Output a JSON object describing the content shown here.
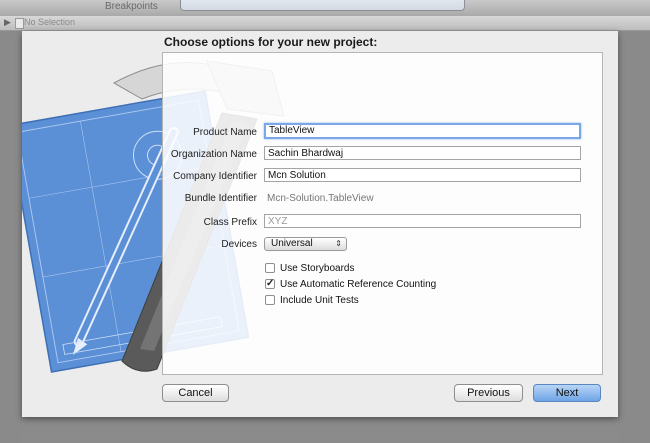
{
  "toolbar": {
    "breakpoints_label": "Breakpoints"
  },
  "jumpbar": {
    "crumb": "No Selection"
  },
  "sheet": {
    "title": "Choose options for your new project:",
    "fields": {
      "product_name": {
        "label": "Product Name",
        "value": "TableView"
      },
      "organization_name": {
        "label": "Organization Name",
        "value": "Sachin Bhardwaj"
      },
      "company_identifier": {
        "label": "Company Identifier",
        "value": "Mcn Solution"
      },
      "bundle_identifier": {
        "label": "Bundle Identifier",
        "value": "Mcn-Solution.TableView"
      },
      "class_prefix": {
        "label": "Class Prefix",
        "placeholder": "XYZ"
      },
      "devices": {
        "label": "Devices",
        "value": "Universal"
      }
    },
    "checkboxes": [
      {
        "label": "Use Storyboards",
        "checked": false,
        "mark": ""
      },
      {
        "label": "Use Automatic Reference Counting",
        "checked": true,
        "mark": "✓"
      },
      {
        "label": "Include Unit Tests",
        "checked": false,
        "mark": ""
      }
    ],
    "buttons": {
      "cancel": "Cancel",
      "previous": "Previous",
      "next": "Next"
    }
  },
  "colors": {
    "blueprint": "#5b8fd6",
    "primary_button": "#6ea4e6",
    "focus_ring": "#7aa7e6"
  }
}
